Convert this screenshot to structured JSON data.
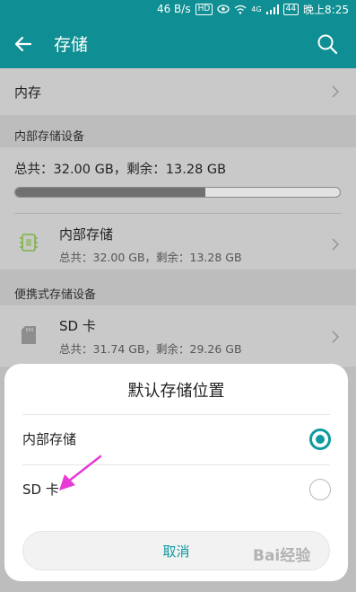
{
  "status_bar": {
    "speed": "46 B/s",
    "hd_badge": "HD",
    "network": "4G",
    "battery": "44",
    "time": "晚上8:25"
  },
  "app_bar": {
    "back_icon": "arrow-left-icon",
    "title": "存储",
    "search_icon": "search-icon"
  },
  "list": {
    "memory_label": "内存",
    "internal_section": "内部存储设备",
    "internal_summary": "总共：32.00 GB，剩余：13.28 GB",
    "internal_usage_fraction": 0.585,
    "internal_item": {
      "title": "内部存储",
      "subtitle": "总共：32.00 GB，剩余：13.28 GB"
    },
    "portable_section": "便携式存储设备",
    "sd_item": {
      "title": "SD 卡",
      "subtitle": "总共：31.74 GB，剩余：29.26 GB"
    }
  },
  "dialog": {
    "title": "默认存储位置",
    "options": [
      {
        "label": "内部存储",
        "selected": true
      },
      {
        "label": "SD 卡",
        "selected": false
      }
    ],
    "cancel_label": "取消"
  },
  "colors": {
    "accent": "#0e9aa0",
    "app_bar": "#0f8f93",
    "annotation_arrow": "#e83ad6"
  },
  "watermark": "Bai经验"
}
